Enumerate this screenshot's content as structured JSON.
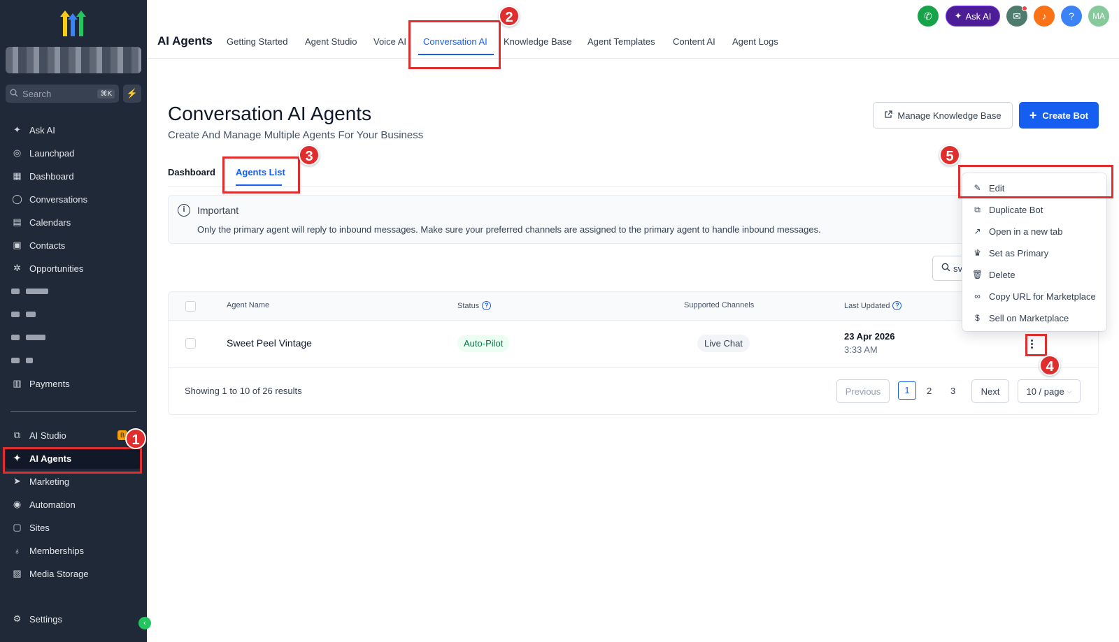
{
  "sidebar": {
    "search_placeholder": "Search",
    "search_shortcut": "⌘K",
    "items": [
      {
        "label": "Ask AI",
        "icon": "sparkle-icon"
      },
      {
        "label": "Launchpad",
        "icon": "rocket-icon"
      },
      {
        "label": "Dashboard",
        "icon": "dashboard-icon"
      },
      {
        "label": "Conversations",
        "icon": "chat-icon"
      },
      {
        "label": "Calendars",
        "icon": "calendar-icon"
      },
      {
        "label": "Contacts",
        "icon": "contacts-icon"
      },
      {
        "label": "Opportunities",
        "icon": "opportunities-icon"
      },
      {
        "label": "Payments",
        "icon": "payments-icon"
      },
      {
        "label": "AI Studio",
        "icon": "ai-studio-icon"
      },
      {
        "label": "AI Agents",
        "icon": "sparkle-icon"
      },
      {
        "label": "Marketing",
        "icon": "send-icon"
      },
      {
        "label": "Automation",
        "icon": "automation-icon"
      },
      {
        "label": "Sites",
        "icon": "sites-icon"
      },
      {
        "label": "Memberships",
        "icon": "award-icon"
      },
      {
        "label": "Media Storage",
        "icon": "image-icon"
      },
      {
        "label": "Settings",
        "icon": "gear-icon"
      }
    ]
  },
  "topbar": {
    "title": "AI Agents",
    "tabs": [
      "Getting Started",
      "Agent Studio",
      "Voice AI",
      "Conversation AI",
      "Knowledge Base",
      "Agent Templates",
      "Content AI",
      "Agent Logs"
    ],
    "active_tab": "Conversation AI",
    "ask_ai": "Ask AI",
    "avatar": "MA",
    "help": "?"
  },
  "page": {
    "title": "Conversation AI Agents",
    "subtitle": "Create And Manage Multiple Agents For Your Business",
    "manage_kb": "Manage Knowledge Base",
    "create_bot": "Create Bot",
    "tabs": [
      "Dashboard",
      "Agents List"
    ],
    "active_tab": "Agents List",
    "notice_title": "Important",
    "notice_text": "Only the primary agent will reply to inbound messages. Make sure your preferred channels are assigned to the primary agent to handle inbound messages.",
    "search_value": "sv"
  },
  "table": {
    "columns": [
      "Agent Name",
      "Status",
      "Supported Channels",
      "Last Updated"
    ],
    "rows": [
      {
        "name": "Sweet Peel Vintage",
        "status": "Auto-Pilot",
        "channels": "Live Chat",
        "date": "23 Apr 2026",
        "time": "3:33 AM"
      }
    ],
    "showing": "Showing 1 to 10 of 26 results",
    "previous": "Previous",
    "next": "Next",
    "pages": [
      "1",
      "2",
      "3"
    ],
    "per_page": "10 / page"
  },
  "menu": {
    "items": [
      {
        "label": "Edit",
        "icon": "pencil-icon"
      },
      {
        "label": "Duplicate Bot",
        "icon": "copy-icon"
      },
      {
        "label": "Open in a new tab",
        "icon": "external-link-icon"
      },
      {
        "label": "Set as Primary",
        "icon": "crown-icon"
      },
      {
        "label": "Delete",
        "icon": "trash-icon"
      },
      {
        "label": "Copy URL for Marketplace",
        "icon": "link-icon"
      },
      {
        "label": "Sell on Marketplace",
        "icon": "dollar-icon"
      }
    ]
  },
  "annotations": [
    "1",
    "2",
    "3",
    "4",
    "5"
  ],
  "colors": {
    "accent": "#155eef",
    "sidebar": "#1f2937",
    "annotation": "#e02d2d",
    "success": "#027a48"
  }
}
